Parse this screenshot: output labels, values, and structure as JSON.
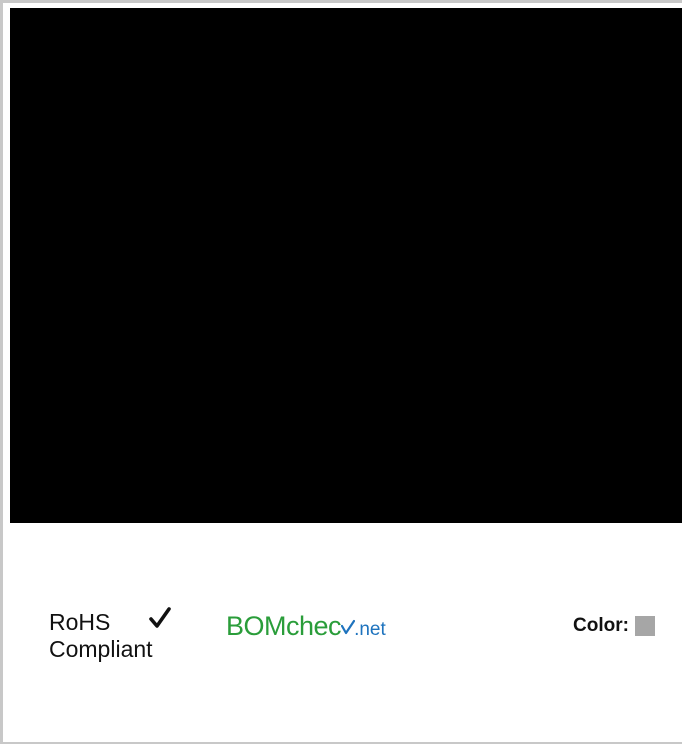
{
  "compliance": {
    "rohs_line1": "RoHS",
    "rohs_line2": "Compliant"
  },
  "bomcheck": {
    "bom": "BOM",
    "check": "chec",
    "net": ".net",
    "icon": "check-mark-icon"
  },
  "color": {
    "label": "Color:",
    "swatch": "#a6a6a6"
  },
  "colors": {
    "image_background": "#000000",
    "bomcheck_green": "#2a9d3a",
    "bomcheck_blue": "#1e73be"
  }
}
